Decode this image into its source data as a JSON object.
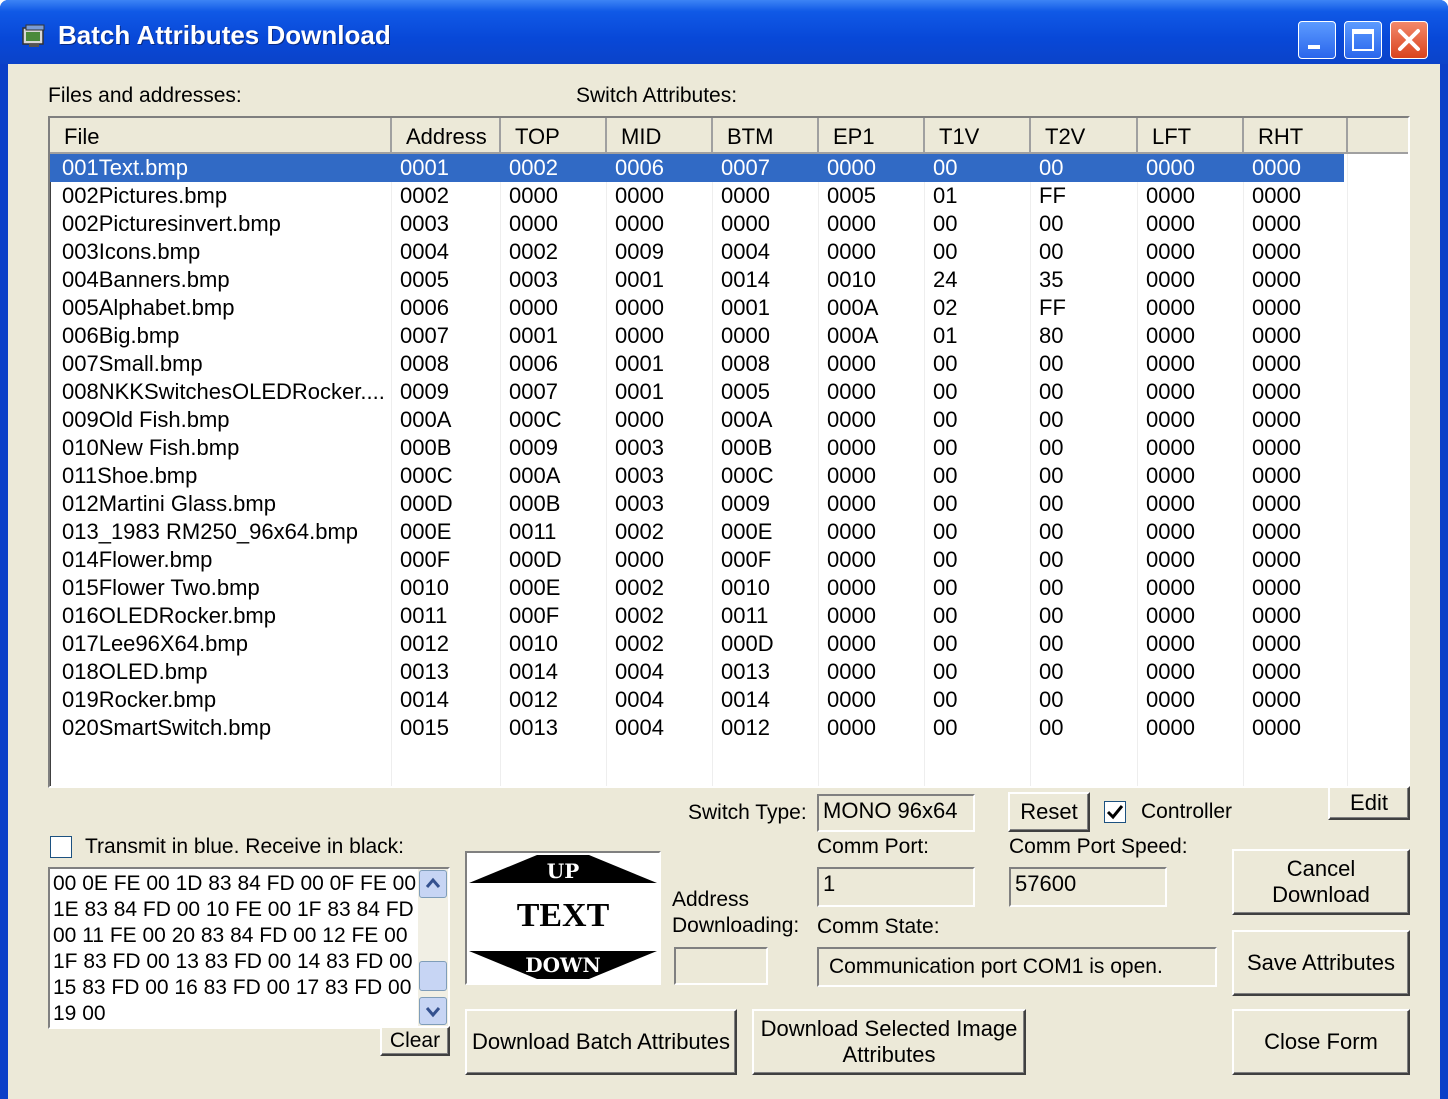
{
  "window": {
    "title": "Batch Attributes Download"
  },
  "labels": {
    "files_and_addresses": "Files and addresses:",
    "switch_attributes": "Switch Attributes:",
    "switch_type": "Switch Type:",
    "comm_port": "Comm Port:",
    "comm_port_speed": "Comm Port Speed:",
    "address_downloading_1": "Address",
    "address_downloading_2": "Downloading:",
    "comm_state": "Comm State:",
    "transmit": "Transmit in blue. Receive in black:",
    "controller": "Controller"
  },
  "table": {
    "columns": [
      "File",
      "Address",
      "TOP",
      "MID",
      "BTM",
      "EP1",
      "T1V",
      "T2V",
      "LFT",
      "RHT"
    ],
    "rows": [
      [
        "001Text.bmp",
        "0001",
        "0002",
        "0006",
        "0007",
        "0000",
        "00",
        "00",
        "0000",
        "0000"
      ],
      [
        "002Pictures.bmp",
        "0002",
        "0000",
        "0000",
        "0000",
        "0005",
        "01",
        "FF",
        "0000",
        "0000"
      ],
      [
        "002Picturesinvert.bmp",
        "0003",
        "0000",
        "0000",
        "0000",
        "0000",
        "00",
        "00",
        "0000",
        "0000"
      ],
      [
        "003Icons.bmp",
        "0004",
        "0002",
        "0009",
        "0004",
        "0000",
        "00",
        "00",
        "0000",
        "0000"
      ],
      [
        "004Banners.bmp",
        "0005",
        "0003",
        "0001",
        "0014",
        "0010",
        "24",
        "35",
        "0000",
        "0000"
      ],
      [
        "005Alphabet.bmp",
        "0006",
        "0000",
        "0000",
        "0001",
        "000A",
        "02",
        "FF",
        "0000",
        "0000"
      ],
      [
        "006Big.bmp",
        "0007",
        "0001",
        "0000",
        "0000",
        "000A",
        "01",
        "80",
        "0000",
        "0000"
      ],
      [
        "007Small.bmp",
        "0008",
        "0006",
        "0001",
        "0008",
        "0000",
        "00",
        "00",
        "0000",
        "0000"
      ],
      [
        "008NKKSwitchesOLEDRocker....",
        "0009",
        "0007",
        "0001",
        "0005",
        "0000",
        "00",
        "00",
        "0000",
        "0000"
      ],
      [
        "009Old Fish.bmp",
        "000A",
        "000C",
        "0000",
        "000A",
        "0000",
        "00",
        "00",
        "0000",
        "0000"
      ],
      [
        "010New Fish.bmp",
        "000B",
        "0009",
        "0003",
        "000B",
        "0000",
        "00",
        "00",
        "0000",
        "0000"
      ],
      [
        "011Shoe.bmp",
        "000C",
        "000A",
        "0003",
        "000C",
        "0000",
        "00",
        "00",
        "0000",
        "0000"
      ],
      [
        "012Martini Glass.bmp",
        "000D",
        "000B",
        "0003",
        "0009",
        "0000",
        "00",
        "00",
        "0000",
        "0000"
      ],
      [
        "013_1983 RM250_96x64.bmp",
        "000E",
        "0011",
        "0002",
        "000E",
        "0000",
        "00",
        "00",
        "0000",
        "0000"
      ],
      [
        "014Flower.bmp",
        "000F",
        "000D",
        "0000",
        "000F",
        "0000",
        "00",
        "00",
        "0000",
        "0000"
      ],
      [
        "015Flower Two.bmp",
        "0010",
        "000E",
        "0002",
        "0010",
        "0000",
        "00",
        "00",
        "0000",
        "0000"
      ],
      [
        "016OLEDRocker.bmp",
        "0011",
        "000F",
        "0002",
        "0011",
        "0000",
        "00",
        "00",
        "0000",
        "0000"
      ],
      [
        "017Lee96X64.bmp",
        "0012",
        "0010",
        "0002",
        "000D",
        "0000",
        "00",
        "00",
        "0000",
        "0000"
      ],
      [
        "018OLED.bmp",
        "0013",
        "0014",
        "0004",
        "0013",
        "0000",
        "00",
        "00",
        "0000",
        "0000"
      ],
      [
        "019Rocker.bmp",
        "0014",
        "0012",
        "0004",
        "0014",
        "0000",
        "00",
        "00",
        "0000",
        "0000"
      ],
      [
        "020SmartSwitch.bmp",
        "0015",
        "0013",
        "0004",
        "0012",
        "0000",
        "00",
        "00",
        "0000",
        "0000"
      ]
    ],
    "selected_row": 0
  },
  "fields": {
    "switch_type": "MONO 96x64",
    "comm_port": "1",
    "comm_port_speed": "57600",
    "address_downloading": "",
    "comm_state": "Communication port COM1 is open."
  },
  "controller_checked": true,
  "transmit_checked": false,
  "log_text": "00 0E FE 00 1D 83 84 FD 00 0F FE 00 1E 83 84 FD 00 10 FE 00 1F 83 84 FD 00 11 FE 00 20 83 84 FD 00 12 FE 00 1F 83 FD 00 13 83 FD 00 14 83 FD 00 15 83 FD 00 16 83 FD 00 17 83 FD 00 19 00",
  "buttons": {
    "reset": "Reset",
    "edit": "Edit",
    "cancel_download_1": "Cancel",
    "cancel_download_2": "Download",
    "save_attributes": "Save Attributes",
    "close_form": "Close Form",
    "download_batch": "Download Batch Attributes",
    "download_selected_1": "Download Selected Image",
    "download_selected_2": "Attributes",
    "clear": "Clear"
  },
  "preview": {
    "top": "UP",
    "middle": "TEXT",
    "bottom": "DOWN"
  },
  "icons": {
    "app": "app-icon",
    "minimize": "minimize-icon",
    "maximize": "maximize-icon",
    "close": "close-icon",
    "scroll_up": "arrow-up-icon",
    "scroll_down": "arrow-down-icon",
    "checkmark": "checkmark-icon"
  },
  "colors": {
    "selection": "#316ac5",
    "titlebar": "#0848d8",
    "dialog_bg": "#ece9d8"
  }
}
